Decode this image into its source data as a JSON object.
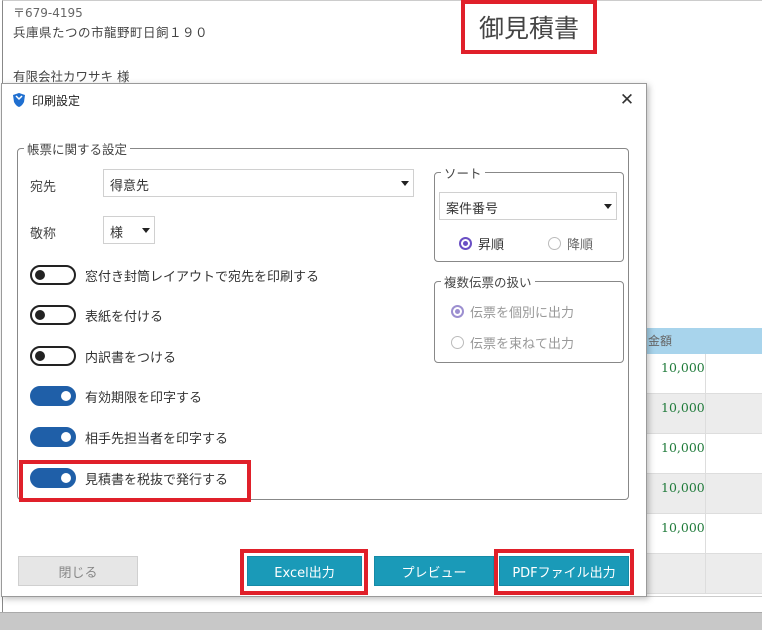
{
  "document": {
    "postal": "〒679-4195",
    "address": "兵庫県たつの市龍野町日飼１９０",
    "customer": "有限会社カワサキ 様",
    "title": "御見積書",
    "table_header": "金額",
    "amounts": [
      "10,000",
      "10,000",
      "10,000",
      "10,000",
      "10,000"
    ]
  },
  "dialog": {
    "title": "印刷設定",
    "close_symbol": "✕",
    "main_group": {
      "legend": "帳票に関する設定",
      "recipient_label": "宛先",
      "recipient_value": "得意先",
      "honorific_label": "敬称",
      "honorific_value": "様",
      "toggles": [
        {
          "label": "窓付き封筒レイアウトで宛先を印刷する",
          "state": "off"
        },
        {
          "label": "表紙を付ける",
          "state": "off"
        },
        {
          "label": "内訳書をつける",
          "state": "off"
        },
        {
          "label": "有効期限を印字する",
          "state": "on"
        },
        {
          "label": "相手先担当者を印字する",
          "state": "on"
        },
        {
          "label": "見積書を税抜で発行する",
          "state": "on"
        }
      ]
    },
    "sort_group": {
      "legend": "ソート",
      "sort_value": "案件番号",
      "ascending": "昇順",
      "descending": "降順",
      "selected": "ascending"
    },
    "multi_group": {
      "legend": "複数伝票の扱い",
      "option_individual": "伝票を個別に出力",
      "option_bundle": "伝票を束ねて出力",
      "selected": "individual"
    },
    "buttons": {
      "close": "閉じる",
      "excel": "Excel出力",
      "preview": "プレビュー",
      "pdf": "PDFファイル出力"
    }
  },
  "colors": {
    "highlight": "#e0202a",
    "toggle_on": "#1f5fa8",
    "button_teal": "#1a9ab8",
    "radio_accent": "#6a4fc4"
  }
}
